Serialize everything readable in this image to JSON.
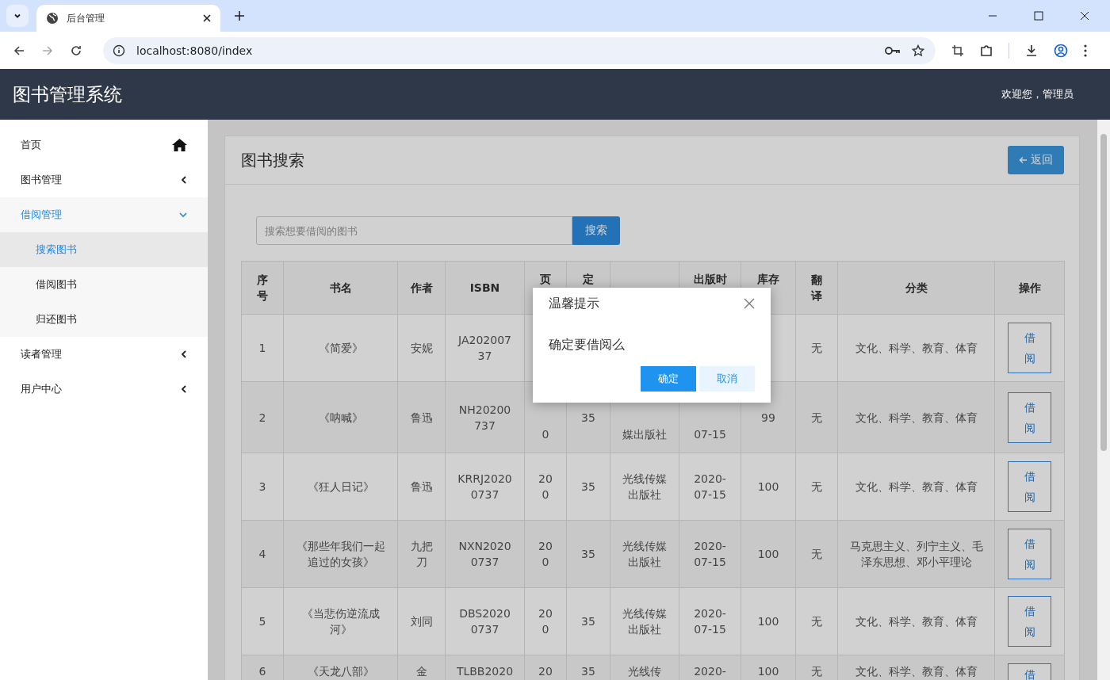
{
  "browser": {
    "tab_title": "后台管理",
    "url": "localhost:8080/index"
  },
  "header": {
    "title": "图书管理系统",
    "welcome": "欢迎您，管理员"
  },
  "sidebar": {
    "items": [
      {
        "label": "首页",
        "kind": "link",
        "expanded": false
      },
      {
        "label": "图书管理",
        "kind": "menu",
        "expanded": false
      },
      {
        "label": "借阅管理",
        "kind": "menu",
        "expanded": true,
        "children": [
          {
            "label": "搜索图书",
            "selected": true
          },
          {
            "label": "借阅图书",
            "selected": false
          },
          {
            "label": "归还图书",
            "selected": false
          }
        ]
      },
      {
        "label": "读者管理",
        "kind": "menu",
        "expanded": false
      },
      {
        "label": "用户中心",
        "kind": "menu",
        "expanded": false
      }
    ]
  },
  "page": {
    "title": "图书搜索",
    "back_button": "返回",
    "search": {
      "placeholder": "搜索想要借阅的图书",
      "button": "搜索"
    },
    "table": {
      "columns": [
        "序号",
        "书名",
        "作者",
        "ISBN",
        {
          "text": "页",
          "covered_below": true
        },
        {
          "text": "定",
          "covered_below": true
        },
        null,
        {
          "text": "出版时",
          "covered_below": true
        },
        {
          "text": "库存",
          "covered_below": true
        },
        "翻译",
        "分类",
        "操作"
      ],
      "rows": [
        {
          "cells": [
            "1",
            "《简爱》",
            "安妮",
            "JA20200737",
            null,
            null,
            null,
            null,
            null,
            "无",
            "文化、科学、教育、体育"
          ],
          "action": "借阅"
        },
        {
          "cells": [
            "2",
            "《呐喊》",
            "鲁迅",
            "NH20200737",
            {
              "text": "0",
              "covered_above": true
            },
            "35",
            {
              "text": "媒出版社",
              "covered_above": true
            },
            {
              "text": "07-15",
              "covered_above": true
            },
            "99",
            "无",
            "文化、科学、教育、体育"
          ],
          "action": "借阅"
        },
        {
          "cells": [
            "3",
            "《狂人日记》",
            "鲁迅",
            "KRRJ20200737",
            "200",
            "35",
            "光线传媒出版社",
            "2020-07-15",
            "100",
            "无",
            "文化、科学、教育、体育"
          ],
          "action": "借阅"
        },
        {
          "cells": [
            "4",
            "《那些年我们一起追过的女孩》",
            "九把刀",
            "NXN20200737",
            "200",
            "35",
            "光线传媒出版社",
            "2020-07-15",
            "100",
            "无",
            "马克思主义、列宁主义、毛泽东思想、邓小平理论"
          ],
          "action": "借阅"
        },
        {
          "cells": [
            "5",
            "《当悲伤逆流成河》",
            "刘同",
            "DBS20200737",
            "200",
            "35",
            "光线传媒出版社",
            "2020-07-15",
            "100",
            "无",
            "文化、科学、教育、体育"
          ],
          "action": "借阅"
        },
        {
          "cut_below": true,
          "cells": [
            "6",
            "《天龙八部》",
            "金",
            "TLBB2020",
            "20",
            "35",
            "光线传",
            "2020-",
            "100",
            "无",
            "文化、科学、教育、体育"
          ],
          "action": "借"
        }
      ]
    }
  },
  "dialog": {
    "title": "温馨提示",
    "message": "确定要借阅么",
    "confirm": "确定",
    "cancel": "取消"
  }
}
